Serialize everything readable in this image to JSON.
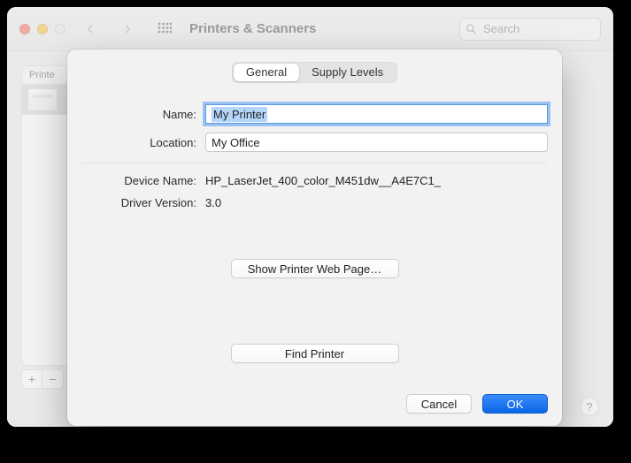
{
  "window": {
    "title": "Printers & Scanners",
    "search_placeholder": "Search"
  },
  "sidebar": {
    "header_label": "Printe",
    "add_label": "+",
    "remove_label": "−"
  },
  "help_label": "?",
  "sheet": {
    "tabs": {
      "general": "General",
      "supply": "Supply Levels",
      "selected": "general"
    },
    "fields": {
      "name_label": "Name:",
      "name_value": "My Printer",
      "location_label": "Location:",
      "location_value": "My Office",
      "device_name_label": "Device Name:",
      "device_name_value": "HP_LaserJet_400_color_M451dw__A4E7C1_",
      "driver_version_label": "Driver Version:",
      "driver_version_value": "3.0"
    },
    "buttons": {
      "show_web_page": "Show Printer Web Page…",
      "find_printer": "Find Printer",
      "cancel": "Cancel",
      "ok": "OK"
    }
  }
}
